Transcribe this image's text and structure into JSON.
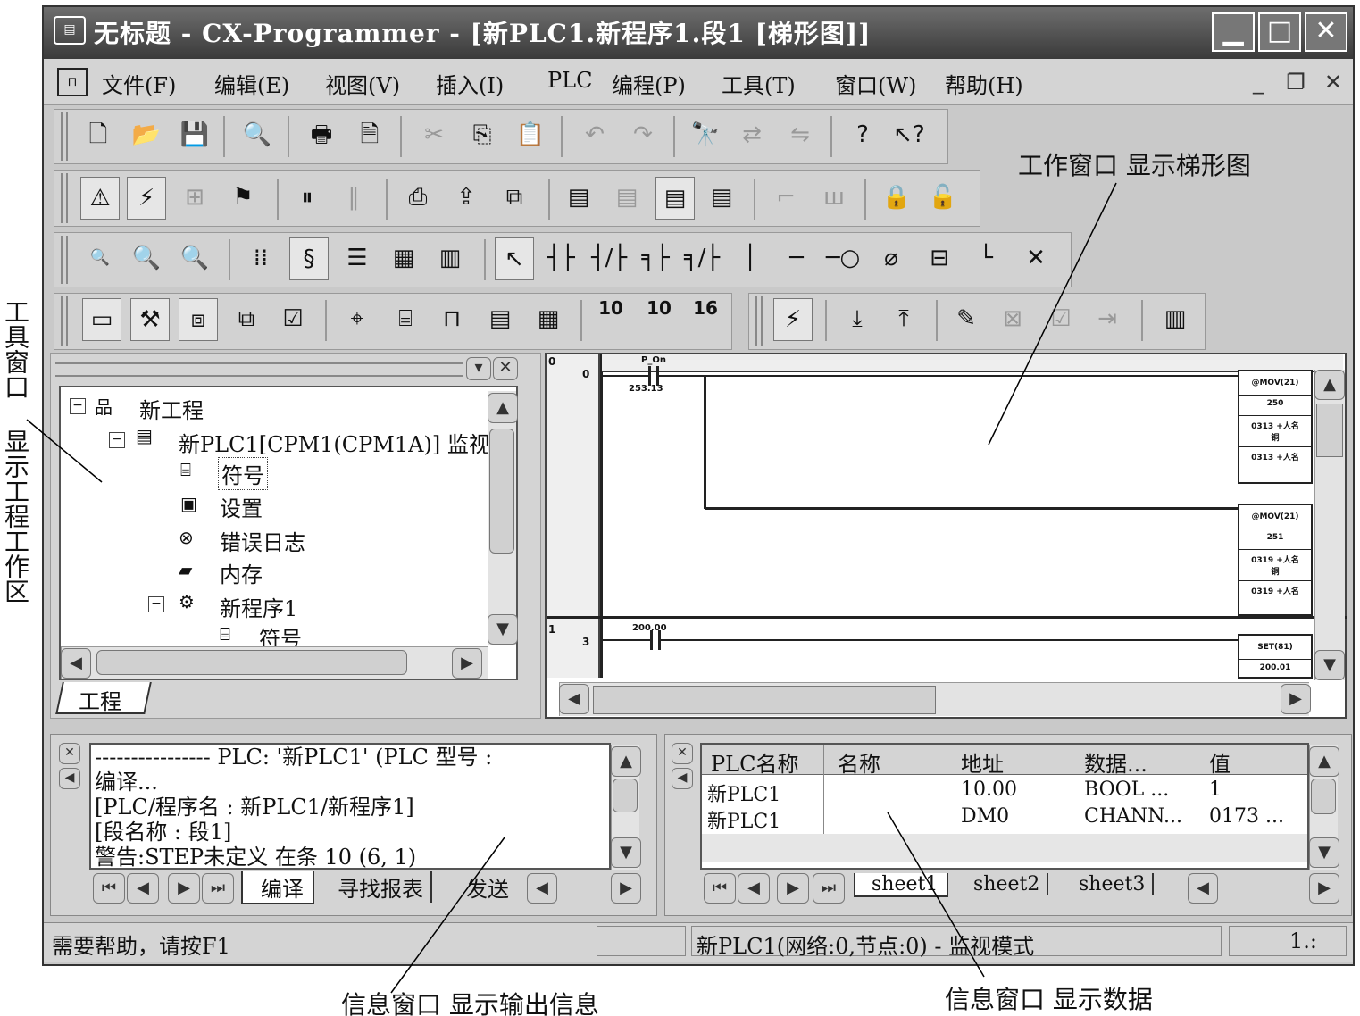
{
  "window": {
    "title": "无标题 - CX-Programmer - [新PLC1.新程序1.段1 [梯形图]]",
    "app_icon": "plc-icon",
    "buttons": {
      "minimize": "▁",
      "maximize": "□",
      "close": "✕"
    }
  },
  "menu": {
    "items": [
      "文件(F)",
      "编辑(E)",
      "视图(V)",
      "插入(I)",
      "PLC",
      "编程(P)",
      "工具(T)",
      "窗口(W)",
      "帮助(H)"
    ],
    "mdi": {
      "minimize": "_",
      "restore": "❐",
      "close": "✕"
    }
  },
  "toolbar": {
    "numeric": {
      "bin": "10",
      "dec": "10",
      "hex": "16"
    }
  },
  "project_tree": {
    "items": [
      {
        "label": "新工程"
      },
      {
        "label": "新PLC1[CPM1(CPM1A)] 监视"
      },
      {
        "label": "符号"
      },
      {
        "label": "设置"
      },
      {
        "label": "错误日志"
      },
      {
        "label": "内存"
      },
      {
        "label": "新程序1"
      },
      {
        "label": "符号"
      }
    ],
    "tab": "工程"
  },
  "ladder": {
    "rungs": [
      {
        "number": "0",
        "step": "0",
        "contact": "P_On",
        "contact_addr": "253.13"
      },
      {
        "number": "1",
        "step": "3",
        "contact": "200.00"
      }
    ],
    "blocks": [
      {
        "title": "@MOV(21)",
        "arg1": "250",
        "arg2": "0313 +人名",
        "arg3": "铜",
        "arg4": "0313 +人名"
      },
      {
        "title": "@MOV(21)",
        "arg1": "251",
        "arg2": "0319 +人名",
        "arg3": "铜",
        "arg4": "0319 +人名"
      },
      {
        "title": "SET(81)",
        "arg1": "200.01"
      }
    ]
  },
  "output_pane": {
    "lines": [
      "---------------- PLC: '新PLC1' (PLC 型号 :",
      "编译...",
      "[PLC/程序名 : 新PLC1/新程序1]",
      "[段名称 : 段1]",
      "警告:STEP未定义 在条 10 (6, 1)"
    ],
    "tabs": [
      "编译",
      "寻找报表",
      "发送"
    ]
  },
  "watch_pane": {
    "columns": [
      "PLC名称",
      "名称",
      "地址",
      "数据...",
      "值"
    ],
    "rows": [
      [
        "新PLC1",
        "",
        "10.00",
        "BOOL ...",
        "1"
      ],
      [
        "新PLC1",
        "",
        "DM0",
        "CHANN...",
        "0173 ..."
      ]
    ],
    "tabs": [
      "sheet1",
      "sheet2",
      "sheet3"
    ]
  },
  "status": {
    "help": "需要帮助，请按F1",
    "mode": "新PLC1(网络:0,节点:0) - 监视模式",
    "extra": "1.:"
  },
  "annotations": {
    "tool_window": "工具窗口",
    "show_project": "显示工程工作区",
    "work_window": "工作窗口 显示梯形图",
    "info_output": "信息窗口 显示输出信息",
    "info_data": "信息窗口 显示数据"
  }
}
